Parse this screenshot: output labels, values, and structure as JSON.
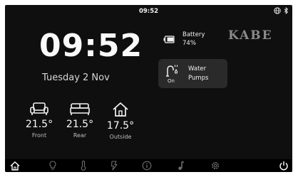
{
  "status_bar": {
    "time": "09:52",
    "icons": [
      "globe-icon",
      "bluetooth-icon"
    ]
  },
  "clock": {
    "time": "09:52",
    "date": "Tuesday 2 Nov"
  },
  "temperatures": [
    {
      "icon": "sofa-icon",
      "value": "21.5°",
      "label": "Front"
    },
    {
      "icon": "bed-icon",
      "value": "21.5°",
      "label": "Rear"
    },
    {
      "icon": "house-icon",
      "value": "17.5°",
      "label": "Outside"
    }
  ],
  "battery": {
    "icon": "battery-icon",
    "label": "Battery",
    "value": "74%",
    "level": 0.74
  },
  "brand": {
    "logo_text": "KABE"
  },
  "water": {
    "icon": "faucet-icon",
    "state": "On",
    "label_line1": "Water",
    "label_line2": "Pumps"
  },
  "navbar": {
    "items": [
      "home-icon",
      "lightbulb-icon",
      "thermometer-icon",
      "power-lightning-icon",
      "info-icon",
      "music-icon",
      "settings-icon",
      "power-icon"
    ]
  },
  "colors": {
    "background": "#0f0f0f",
    "card": "#2a2a2a",
    "text": "#f2f2f2",
    "logo": "#8a8a8a"
  }
}
